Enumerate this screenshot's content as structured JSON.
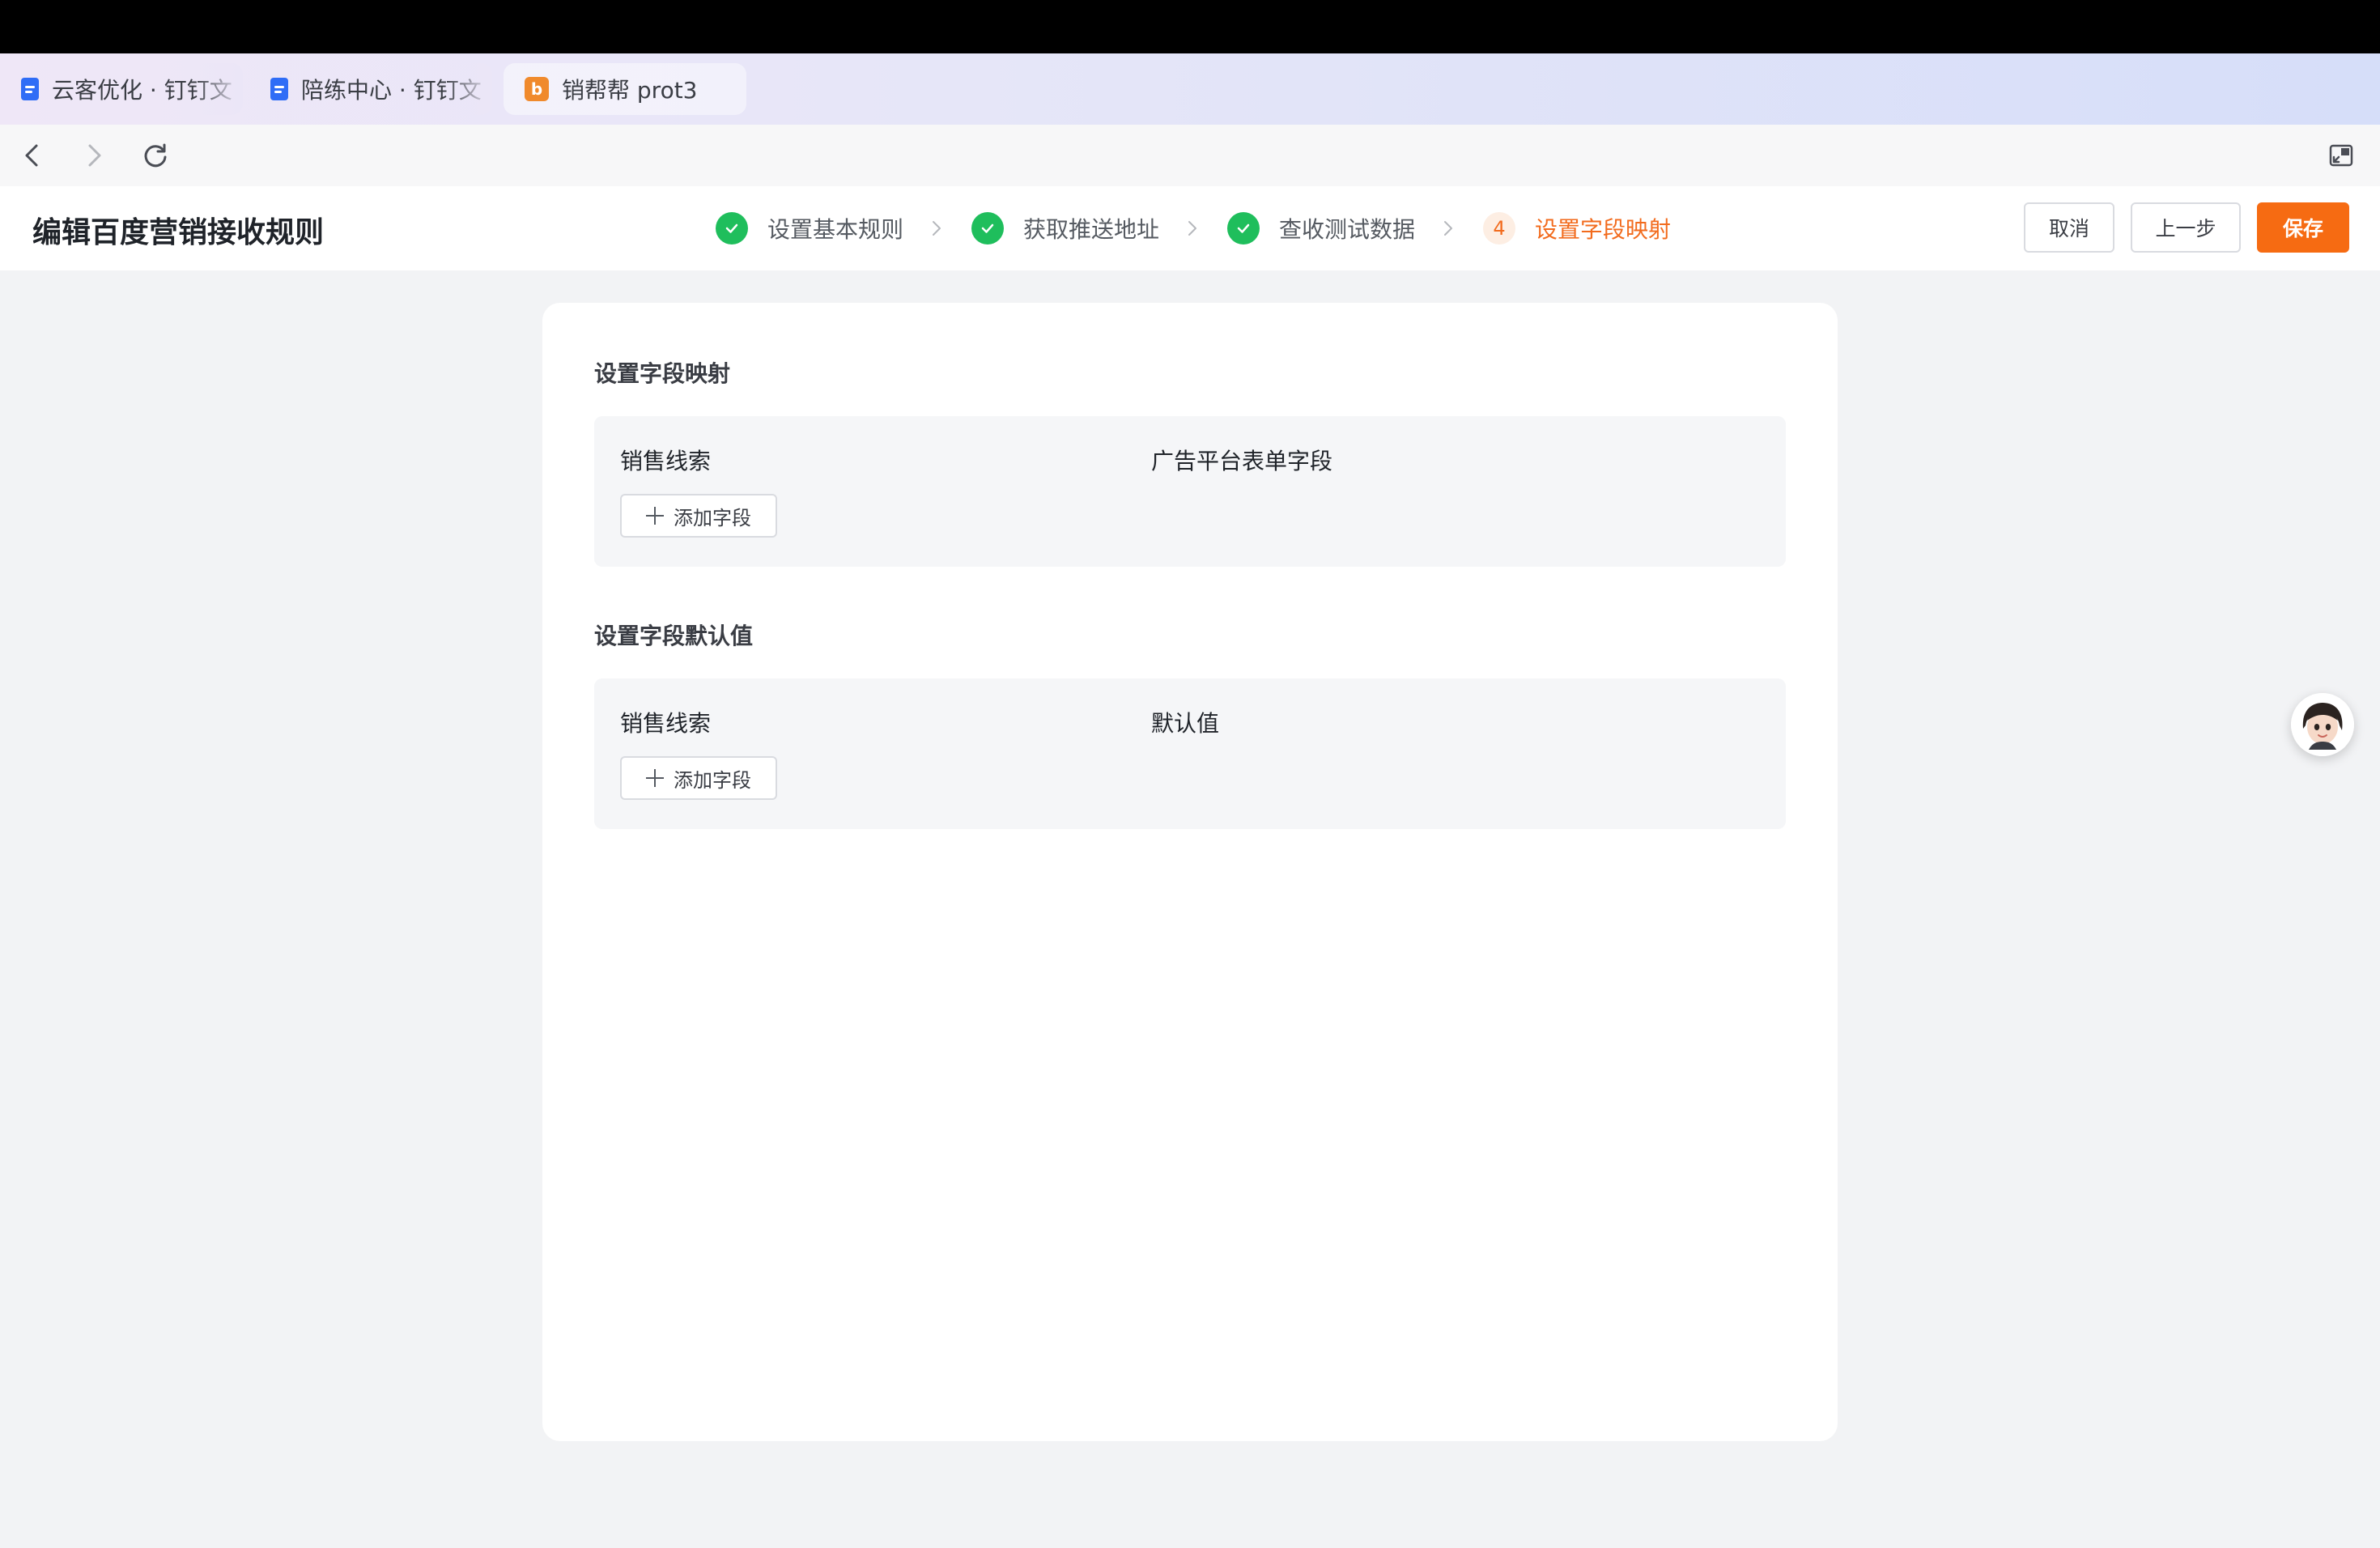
{
  "browser": {
    "tabs": [
      {
        "label": "云客优化 · 钉钉文",
        "icon": "doc-icon"
      },
      {
        "label": "陪练中心 · 钉钉文",
        "icon": "doc-icon"
      },
      {
        "label": "销帮帮 prot3",
        "icon": "b-icon"
      }
    ],
    "favicon_glyph": "b"
  },
  "header": {
    "title": "编辑百度营销接收规则",
    "steps": [
      {
        "label": "设置基本规则",
        "status": "done"
      },
      {
        "label": "获取推送地址",
        "status": "done"
      },
      {
        "label": "查收测试数据",
        "status": "done"
      },
      {
        "label": "设置字段映射",
        "status": "active",
        "number": "4"
      }
    ],
    "cancel_label": "取消",
    "prev_label": "上一步",
    "save_label": "保存"
  },
  "mapping": {
    "title": "设置字段映射",
    "col1": "销售线索",
    "col2": "广告平台表单字段",
    "add_label": "添加字段"
  },
  "defaults": {
    "title": "设置字段默认值",
    "col1": "销售线索",
    "col2": "默认值",
    "add_label": "添加字段"
  },
  "colors": {
    "accent": "#f66b12",
    "success": "#1fbe5c"
  }
}
